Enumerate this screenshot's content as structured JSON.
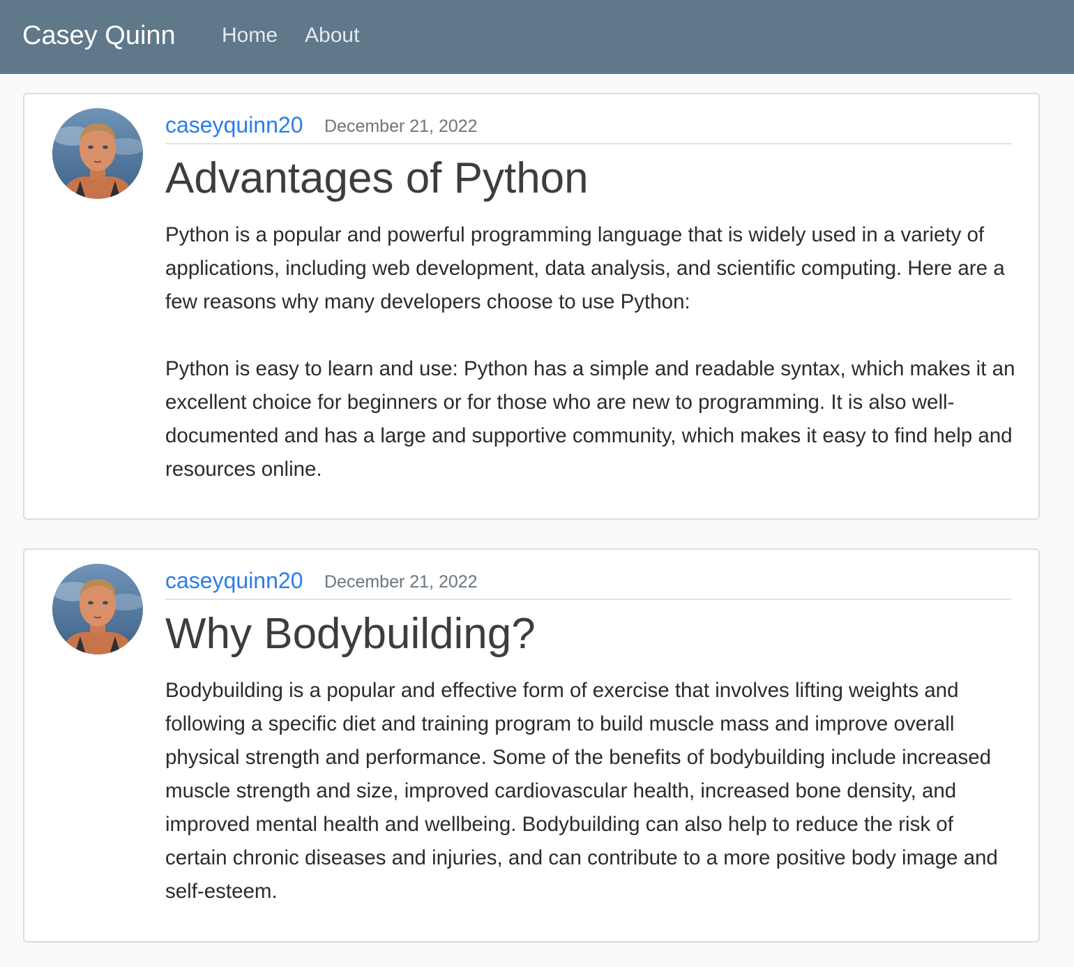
{
  "nav": {
    "brand": "Casey Quinn",
    "links": [
      "Home",
      "About"
    ]
  },
  "posts": [
    {
      "author": "caseyquinn20",
      "date": "December 21, 2022",
      "title": "Advantages of Python",
      "paragraphs": [
        "Python is a popular and powerful programming language that is widely used in a variety of applications, including web development, data analysis, and scientific computing. Here are a few reasons why many developers choose to use Python:",
        "Python is easy to learn and use: Python has a simple and readable syntax, which makes it an excellent choice for beginners or for those who are new to programming. It is also well-documented and has a large and supportive community, which makes it easy to find help and resources online."
      ]
    },
    {
      "author": "caseyquinn20",
      "date": "December 21, 2022",
      "title": "Why Bodybuilding?",
      "paragraphs": [
        "Bodybuilding is a popular and effective form of exercise that involves lifting weights and following a specific diet and training program to build muscle mass and improve overall physical strength and performance. Some of the benefits of bodybuilding include increased muscle strength and size, improved cardiovascular health, increased bone density, and improved mental health and wellbeing. Bodybuilding can also help to reduce the risk of certain chronic diseases and injuries, and can contribute to a more positive body image and self-esteem."
      ]
    }
  ],
  "colors": {
    "navbar": "#5f788a",
    "link": "#2b7de9",
    "muted": "#6c757d"
  }
}
